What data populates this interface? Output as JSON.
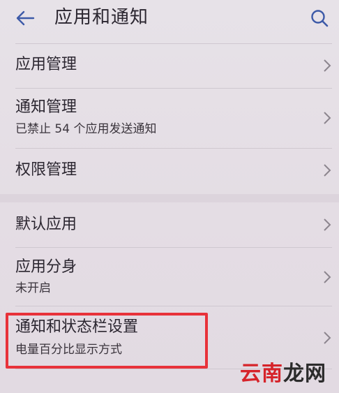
{
  "header": {
    "title": "应用和通知",
    "back_icon": "back-arrow-icon",
    "search_icon": "search-icon"
  },
  "groups": [
    {
      "items": [
        {
          "title": "应用管理",
          "subtitle": ""
        },
        {
          "title": "通知管理",
          "subtitle": "已禁止 54 个应用发送通知"
        },
        {
          "title": "权限管理",
          "subtitle": ""
        }
      ]
    },
    {
      "items": [
        {
          "title": "默认应用",
          "subtitle": ""
        },
        {
          "title": "应用分身",
          "subtitle": "未开启"
        },
        {
          "title": "通知和状态栏设置",
          "subtitle": "电量百分比显示方式"
        }
      ]
    }
  ],
  "watermark": {
    "part1": "云南",
    "part2": "龙网"
  },
  "colors": {
    "accent": "#3d5aa8",
    "highlight": "#e8323a",
    "background": "#e6e0e6"
  }
}
